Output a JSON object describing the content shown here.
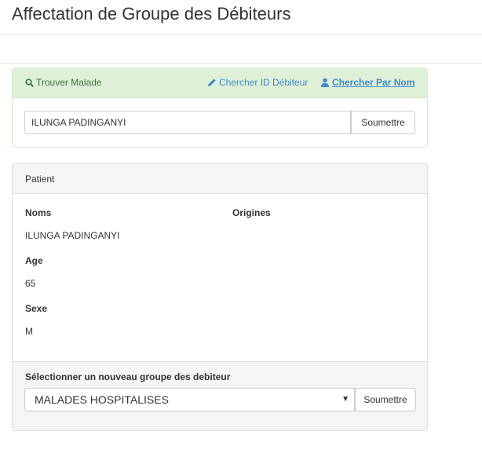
{
  "page": {
    "title": "Affectation de Groupe des Débiteurs"
  },
  "search": {
    "find_label": "Trouver Malade",
    "search_id_label": "Chercher ID Débiteur",
    "search_name_label": "Chercher Par Nom",
    "input_value": "ILUNGA PADINGANYI",
    "submit_label": "Soumettre"
  },
  "patient": {
    "heading": "Patient",
    "names_label": "Noms",
    "names_value": "ILUNGA PADINGANYI",
    "origins_label": "Origines",
    "age_label": "Age",
    "age_value": "65",
    "sex_label": "Sexe",
    "sex_value": "M",
    "new_group_label": "Sélectionner un nouveau groupe des debiteur",
    "group_selected": "MALADES HOSPITALISES",
    "submit_label": "Soumettre"
  },
  "colors": {
    "success_bg": "#dff0d8",
    "success_text": "#3c763d",
    "link": "#428bca"
  },
  "icons": {
    "find": "search-icon",
    "search_id": "pencil-icon",
    "search_name": "user-icon",
    "select": "caret-down-icon"
  }
}
